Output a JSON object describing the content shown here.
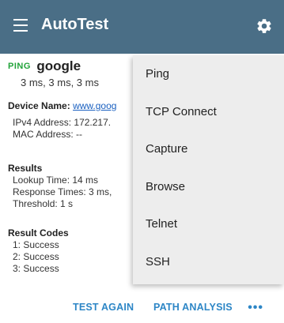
{
  "appbar": {
    "title": "AutoTest"
  },
  "ping": {
    "tag": "PING",
    "target": "google",
    "times": "3 ms, 3 ms, 3 ms"
  },
  "device": {
    "name_label": "Device Name:",
    "name_value": "www.goog",
    "ipv4_label": "IPv4 Address:",
    "ipv4_value": "172.217.",
    "mac_label": "MAC Address:",
    "mac_value": "--"
  },
  "results": {
    "heading": "Results",
    "lookup": "Lookup Time: 14 ms",
    "response": "Response Times: 3 ms,",
    "threshold": "Threshold: 1 s"
  },
  "result_codes": {
    "heading": "Result Codes",
    "codes": [
      "1:  Success",
      "2:  Success",
      "3:  Success"
    ]
  },
  "actions": {
    "test_again": "TEST AGAIN",
    "path_analysis": "PATH ANALYSIS",
    "more": "•••"
  },
  "menu": {
    "items": [
      "Ping",
      "TCP Connect",
      "Capture",
      "Browse",
      "Telnet",
      "SSH"
    ]
  }
}
